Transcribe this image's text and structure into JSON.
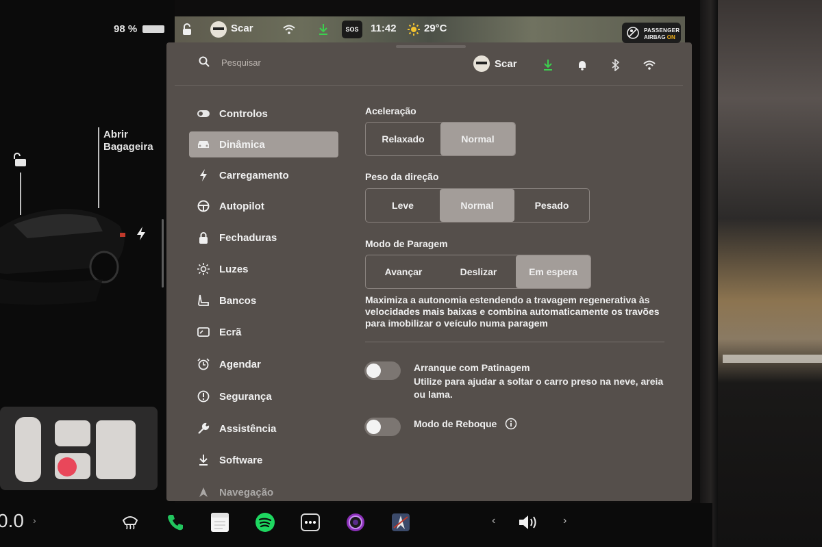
{
  "status_bar": {
    "battery": "98 %",
    "profile": "Scar",
    "sos": "SOS",
    "time": "11:42",
    "temperature": "29°C",
    "airbag_line1": "PASSENGER",
    "airbag_line2_prefix": "AIRBAG ",
    "airbag_line2_state": "ON"
  },
  "car_panel": {
    "trunk_label_1": "Abrir",
    "trunk_label_2": "Bagageira"
  },
  "header": {
    "search_placeholder": "Pesquisar",
    "user": "Scar"
  },
  "sidebar": {
    "items": [
      {
        "label": "Controlos",
        "icon": "toggle-icon"
      },
      {
        "label": "Dinâmica",
        "icon": "car-icon",
        "active": true
      },
      {
        "label": "Carregamento",
        "icon": "bolt-icon"
      },
      {
        "label": "Autopilot",
        "icon": "steering-wheel-icon"
      },
      {
        "label": "Fechaduras",
        "icon": "lock-icon"
      },
      {
        "label": "Luzes",
        "icon": "sun-icon"
      },
      {
        "label": "Bancos",
        "icon": "seat-icon"
      },
      {
        "label": "Ecrã",
        "icon": "display-icon"
      },
      {
        "label": "Agendar",
        "icon": "alarm-clock-icon"
      },
      {
        "label": "Segurança",
        "icon": "alert-circle-icon"
      },
      {
        "label": "Assistência",
        "icon": "wrench-icon"
      },
      {
        "label": "Software",
        "icon": "download-icon"
      },
      {
        "label": "Navegação",
        "icon": "navigation-icon"
      }
    ]
  },
  "dynamics": {
    "acceleration": {
      "title": "Aceleração",
      "options": [
        "Relaxado",
        "Normal"
      ],
      "selected": "Normal"
    },
    "steering": {
      "title": "Peso da direção",
      "options": [
        "Leve",
        "Normal",
        "Pesado"
      ],
      "selected": "Normal"
    },
    "stopping": {
      "title": "Modo de Paragem",
      "options": [
        "Avançar",
        "Deslizar",
        "Em espera"
      ],
      "selected": "Em espera",
      "description": "Maximiza a autonomia estendendo a travagem regenerativa às velocidades mais baixas e combina automaticamente os travões para imobilizar o veículo numa paragem"
    },
    "slip_start": {
      "title": "Arranque com Patinagem",
      "description": "Utilize para ajudar a soltar o carro preso na neve, areia ou lama.",
      "enabled": false
    },
    "tow_mode": {
      "title": "Modo de Reboque",
      "enabled": false
    }
  },
  "dock": {
    "speed": "0.0"
  },
  "colors": {
    "panel_bg": "#554f4b",
    "selected_bg": "#a39d99",
    "download_green": "#3ccf4e",
    "phone_green": "#22c55e",
    "spotify_green": "#1ed760",
    "airbag_on": "#f2b11a"
  }
}
